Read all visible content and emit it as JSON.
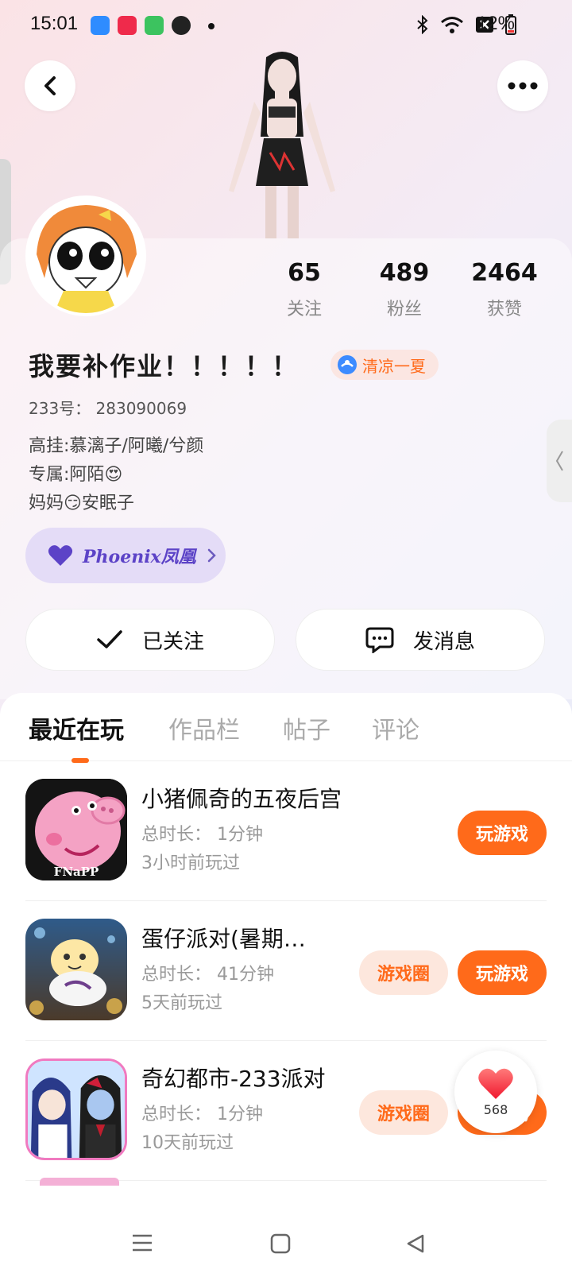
{
  "status_bar": {
    "time": "15:01",
    "battery": "12%"
  },
  "profile": {
    "stats": [
      {
        "num": "65",
        "label": "关注"
      },
      {
        "num": "489",
        "label": "粉丝"
      },
      {
        "num": "2464",
        "label": "获赞"
      }
    ],
    "nickname": "我要补作业！！！！！",
    "badge": "清凉一夏",
    "uid": "233号： 283090069",
    "bio": [
      "高挂:慕漓子/阿曦/兮颜",
      "专属:阿陌😍",
      "妈妈😏安眠子"
    ],
    "phoenix": "Phoenix凤凰",
    "follow_label": "已关注",
    "message_label": "发消息"
  },
  "tabs": [
    "最近在玩",
    "作品栏",
    "帖子",
    "评论"
  ],
  "games": [
    {
      "title": "小猪佩奇的五夜后宫",
      "duration": "总时长： 1分钟",
      "last_played": "3小时前玩过",
      "icon_text": "FNaPP",
      "play_label": "玩游戏",
      "circle_label": ""
    },
    {
      "title": "蛋仔派对(暑期…",
      "duration": "总时长： 41分钟",
      "last_played": "5天前玩过",
      "icon_text": "",
      "play_label": "玩游戏",
      "circle_label": "游戏圈"
    },
    {
      "title": "奇幻都市-233派对",
      "duration": "总时长： 1分钟",
      "last_played": "10天前玩过",
      "icon_text": "",
      "play_label": "玩游戏",
      "circle_label": "游戏圈"
    }
  ],
  "like": {
    "count": "568"
  },
  "colors": {
    "accent": "#ff6a1a",
    "phoenix": "#5c43c7"
  }
}
